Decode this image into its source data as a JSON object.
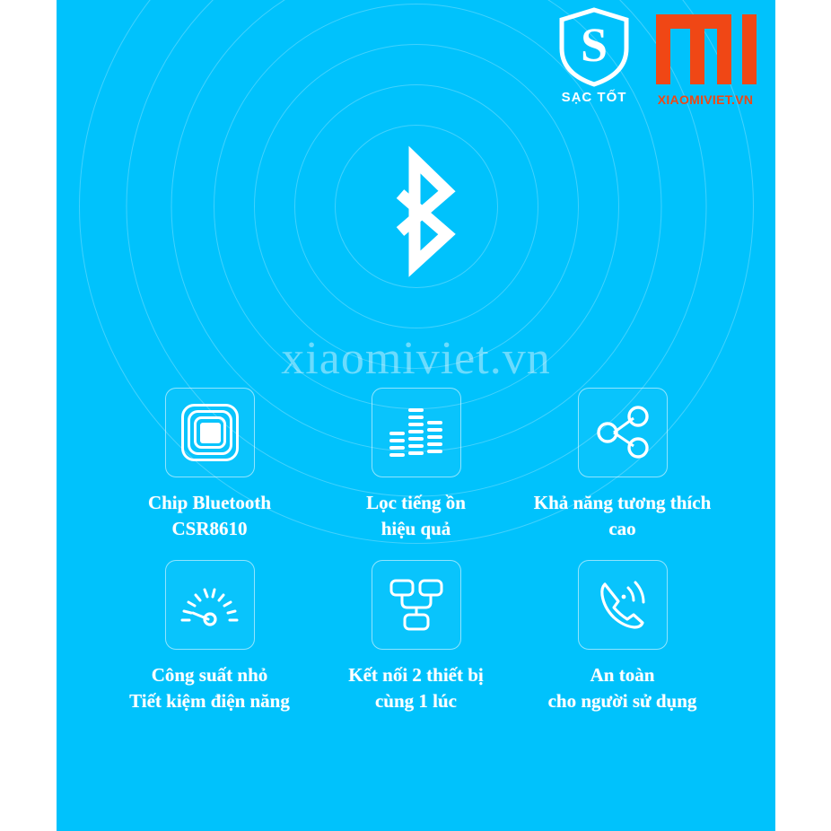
{
  "colors": {
    "panel_blue": "#00c2fc",
    "mi_orange": "#f04715",
    "white": "#ffffff",
    "watermark": "rgba(255,255,255,0.42)"
  },
  "branding": {
    "shield": {
      "icon": "shield-s-icon",
      "letter": "S",
      "label": "SẠC TỐT"
    },
    "mi": {
      "icon": "mi-logo-icon",
      "label": "XIAOMIVIET.VN"
    }
  },
  "hero": {
    "icon": "bluetooth-icon",
    "ripples": 7
  },
  "watermark": {
    "text": "xiaomiviet.vn"
  },
  "features": [
    {
      "icon": "nfc-chip-icon",
      "lines": [
        "Chip Bluetooth",
        "CSR8610"
      ]
    },
    {
      "icon": "equalizer-icon",
      "lines": [
        "Lọc tiếng ồn",
        "hiệu quả"
      ]
    },
    {
      "icon": "share-network-icon",
      "lines": [
        "Khả năng tương thích",
        "cao"
      ]
    },
    {
      "icon": "speedometer-icon",
      "lines": [
        "Công suất nhỏ",
        "Tiết kiệm điện năng"
      ]
    },
    {
      "icon": "two-devices-connect-icon",
      "lines": [
        "Kết nối 2 thiết bị",
        "cùng 1 lúc"
      ]
    },
    {
      "icon": "ringing-phone-icon",
      "lines": [
        "An toàn",
        "cho người sử dụng"
      ]
    }
  ]
}
